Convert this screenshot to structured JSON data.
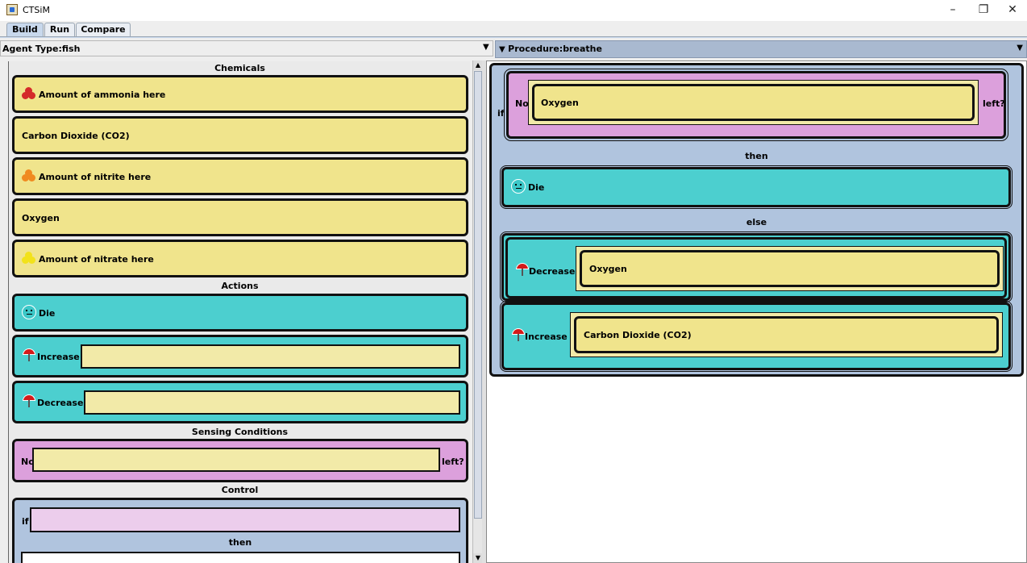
{
  "window": {
    "title": "CTSiM",
    "minimize": "–",
    "restore": "❐",
    "close": "✕"
  },
  "tabs": [
    {
      "label": "Build",
      "selected": true
    },
    {
      "label": "Run"
    },
    {
      "label": "Compare"
    }
  ],
  "agent": {
    "label": "Agent Type:",
    "value": "fish"
  },
  "procedure": {
    "label": "Procedure:",
    "value": "breathe"
  },
  "palette": {
    "sections": {
      "chemicals": "Chemicals",
      "actions": "Actions",
      "sensing": "Sensing Conditions",
      "control": "Control"
    },
    "chemicals": [
      {
        "label": "Amount of ammonia here",
        "icon": "red-blob-icon",
        "color": "#d42a2a"
      },
      {
        "label": "Carbon Dioxide (CO2)"
      },
      {
        "label": "Amount of nitrite here",
        "icon": "orange-blob-icon",
        "color": "#f08a20"
      },
      {
        "label": "Oxygen"
      },
      {
        "label": "Amount of nitrate here",
        "icon": "yellow-blob-icon",
        "color": "#f2e21a"
      }
    ],
    "actions": [
      {
        "label": "Die",
        "icon": "face-icon"
      },
      {
        "label": "Increase",
        "icon": "umbrella-icon"
      },
      {
        "label": "Decrease",
        "icon": "umbrella-icon"
      }
    ],
    "sensing": {
      "prefix": "No",
      "suffix": "left?"
    },
    "control": {
      "if": "if",
      "then": "then"
    }
  },
  "procedure_canvas": {
    "if": "if",
    "condition": {
      "prefix": "No",
      "value": "Oxygen",
      "suffix": "left?"
    },
    "then": "then",
    "then_action": "Die",
    "else": "else",
    "else_actions": [
      {
        "label": "Decrease",
        "value": "Oxygen"
      },
      {
        "label": "Increase",
        "value": "Carbon Dioxide (CO2)"
      }
    ]
  },
  "colors": {
    "chemical": "#f0e48c",
    "action": "#4ccfcf",
    "sensing": "#dca0dc",
    "control": "#b0c4de"
  }
}
